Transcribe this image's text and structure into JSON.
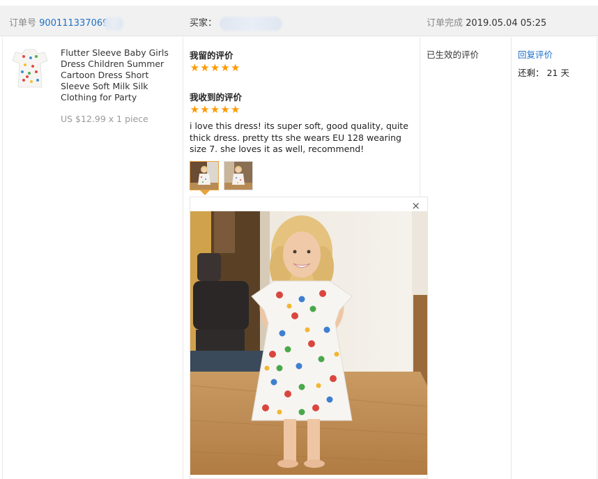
{
  "header": {
    "order_label": "订单号",
    "order_number": "900111337069",
    "buyer_label": "买家：",
    "completion_label": "订单完成",
    "completion_time": "2019.05.04 05:25"
  },
  "product": {
    "title": "Flutter Sleeve Baby Girls Dress Children Summer Cartoon Dress Short Sleeve Soft Milk Silk Clothing for Party",
    "price": "US $12.99 x 1 piece"
  },
  "my_review": {
    "label": "我留的评价",
    "stars": 5
  },
  "received_review": {
    "label": "我收到的评价",
    "stars": 5,
    "text": "i love this dress! its super soft, good quality, quite thick dress. pretty tts she wears EU 128 wearing size 7. she loves it as well, recommend!",
    "photo_count": 2
  },
  "preview": {
    "close_symbol": "×"
  },
  "status_column": {
    "status": "已生效的评价"
  },
  "action_column": {
    "reply_label": "回复评价",
    "remaining": "还剩： 21 天"
  },
  "colors": {
    "link": "#1e6fc7",
    "star": "#ff9a00",
    "header_bg": "#f1f1f1",
    "active_thumb": "#e8a33d"
  }
}
